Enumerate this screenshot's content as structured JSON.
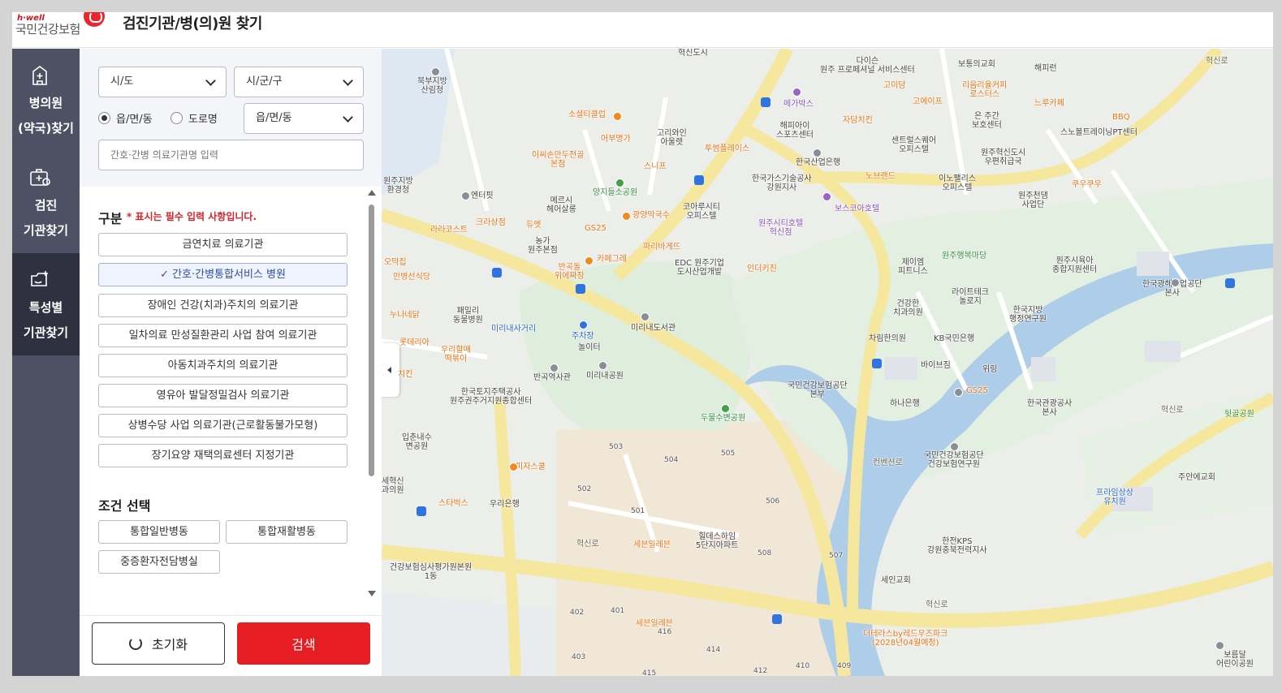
{
  "header": {
    "logo_sub": "h·well",
    "logo_main": "국민건강보험",
    "title": "검진기관/병(의)원 찾기"
  },
  "leftnav": [
    {
      "label": "병의원\n(약국)찾기",
      "icon": "hospital-icon",
      "active": false
    },
    {
      "label": "검진\n기관찾기",
      "icon": "checkup-icon",
      "active": false
    },
    {
      "label": "특성별\n기관찾기",
      "icon": "special-icon",
      "active": true
    }
  ],
  "filters": {
    "sido": "시/도",
    "sigungu": "시/군/구",
    "radio_1": "읍/면/동",
    "radio_2": "도로명",
    "dong": "읍/면/동",
    "name_placeholder": "간호·간병 의료기관명 입력"
  },
  "category": {
    "title": "구분",
    "required_note": "* 표시는 필수 입력 사항입니다.",
    "options": [
      "금연치료 의료기관",
      "✓ 간호·간병통합서비스 병원",
      "장애인 건강(치과)주치의 의료기관",
      "일차의료 만성질환관리 사업 참여 의료기관",
      "아동치과주치의 의료기관",
      "영유아 발달정밀검사 의료기관",
      "상병수당 사업 의료기관(근로활동불가모형)",
      "장기요양 재택의료센터 지정기관"
    ],
    "selected_index": 1
  },
  "conditions": {
    "title": "조건 선택",
    "options": [
      "통합일반병동",
      "통합재활병동",
      "중증환자전담병실"
    ]
  },
  "actions": {
    "reset": "초기화",
    "search": "검색"
  },
  "map": {
    "labels": [
      "북부지방\n산림청",
      "원주지방\n환경청",
      "엔터핏",
      "라라코스트",
      "오막집",
      "만병선식당",
      "누나네닭",
      "롯데리아",
      "치킨",
      "입춘내수\n변공원",
      "세혁신\n과의원",
      "스타벅스",
      "우리은행",
      "피자스쿨",
      "건강보험심사평가원본원\n1동",
      "소셜티클럽",
      "어부명가",
      "이씨손만두전골\n본점",
      "양지들소공원",
      "메르시\n헤어살롱",
      "크라상점",
      "듀엣",
      "GS25",
      "농가\n원주본점",
      "반곡돌\n위에짜장",
      "카페그레",
      "패밀리\n동물병원",
      "미리내사거리",
      "우리할매\n떡볶이",
      "주차장",
      "놀이터",
      "반곡역사관",
      "미리내공원",
      "한국토지주택공사\n원주권주거지원종합센터",
      "미리내도서관",
      "고리와인\n아울렛",
      "스니프",
      "투썸플레이스",
      "광양막국수",
      "파리바게뜨",
      "코아루시티\n오피스텔",
      "EDC 원주기업\n도시산업개발",
      "인더키친",
      "혁신도시",
      "메가박스",
      "해피아이\n스포츠센터",
      "자담치킨",
      "한국산업은행",
      "한국가스기술공사\n강원지사",
      "원주시티호텔\n혁신점",
      "보스코아호텔",
      "다이슨\n원주 프로페셔널 서비스센터",
      "고미담",
      "고에이프",
      "보통의교회",
      "리음리율커피\n로스터스",
      "해피런",
      "느루카페",
      "센트럴스퀘어\n오피스텔",
      "노브랜드",
      "이노팰리스\n오피스텔",
      "은 주간\n보호센터",
      "원주혁신도시\n우편취급국",
      "BBQ",
      "스노볼트레이닝PT센터",
      "원주천댐\n사업단",
      "쿠우쿠우",
      "원주행복마당",
      "원주시육아\n종합지원센터",
      "한국광해광업공단\n본사",
      "제이엠\n피트니스",
      "건강한\n치과의원",
      "라이트테크\n놀로지",
      "한국지방\n행정연구원",
      "차림한의원",
      "KB국민은행",
      "바이브짐",
      "위링",
      "GS25",
      "국민건강보험공단\n본부",
      "하나은행",
      "한국관광공사\n본사",
      "뒷골공원",
      "두물수변공원",
      "국민건강보험공단\n건강보험연구원",
      "주안에교회",
      "프라임상상\n유치원",
      "한전KPS\n강원충북전력지사",
      "세인교회",
      "힐데스하임\n5단지아파트",
      "세븐일레븐",
      "세븐일레븐",
      "더테라스by레드우즈파크\n(2028년04월예정)",
      "보름달\n어린이공원",
      "혁신로",
      "혁신로",
      "혁신로",
      "혁신로",
      "컨벤션로"
    ],
    "numbers": [
      "503",
      "504",
      "505",
      "502",
      "501",
      "506",
      "508",
      "507",
      "402",
      "401",
      "416",
      "414",
      "403",
      "415",
      "412",
      "410",
      "409"
    ]
  }
}
